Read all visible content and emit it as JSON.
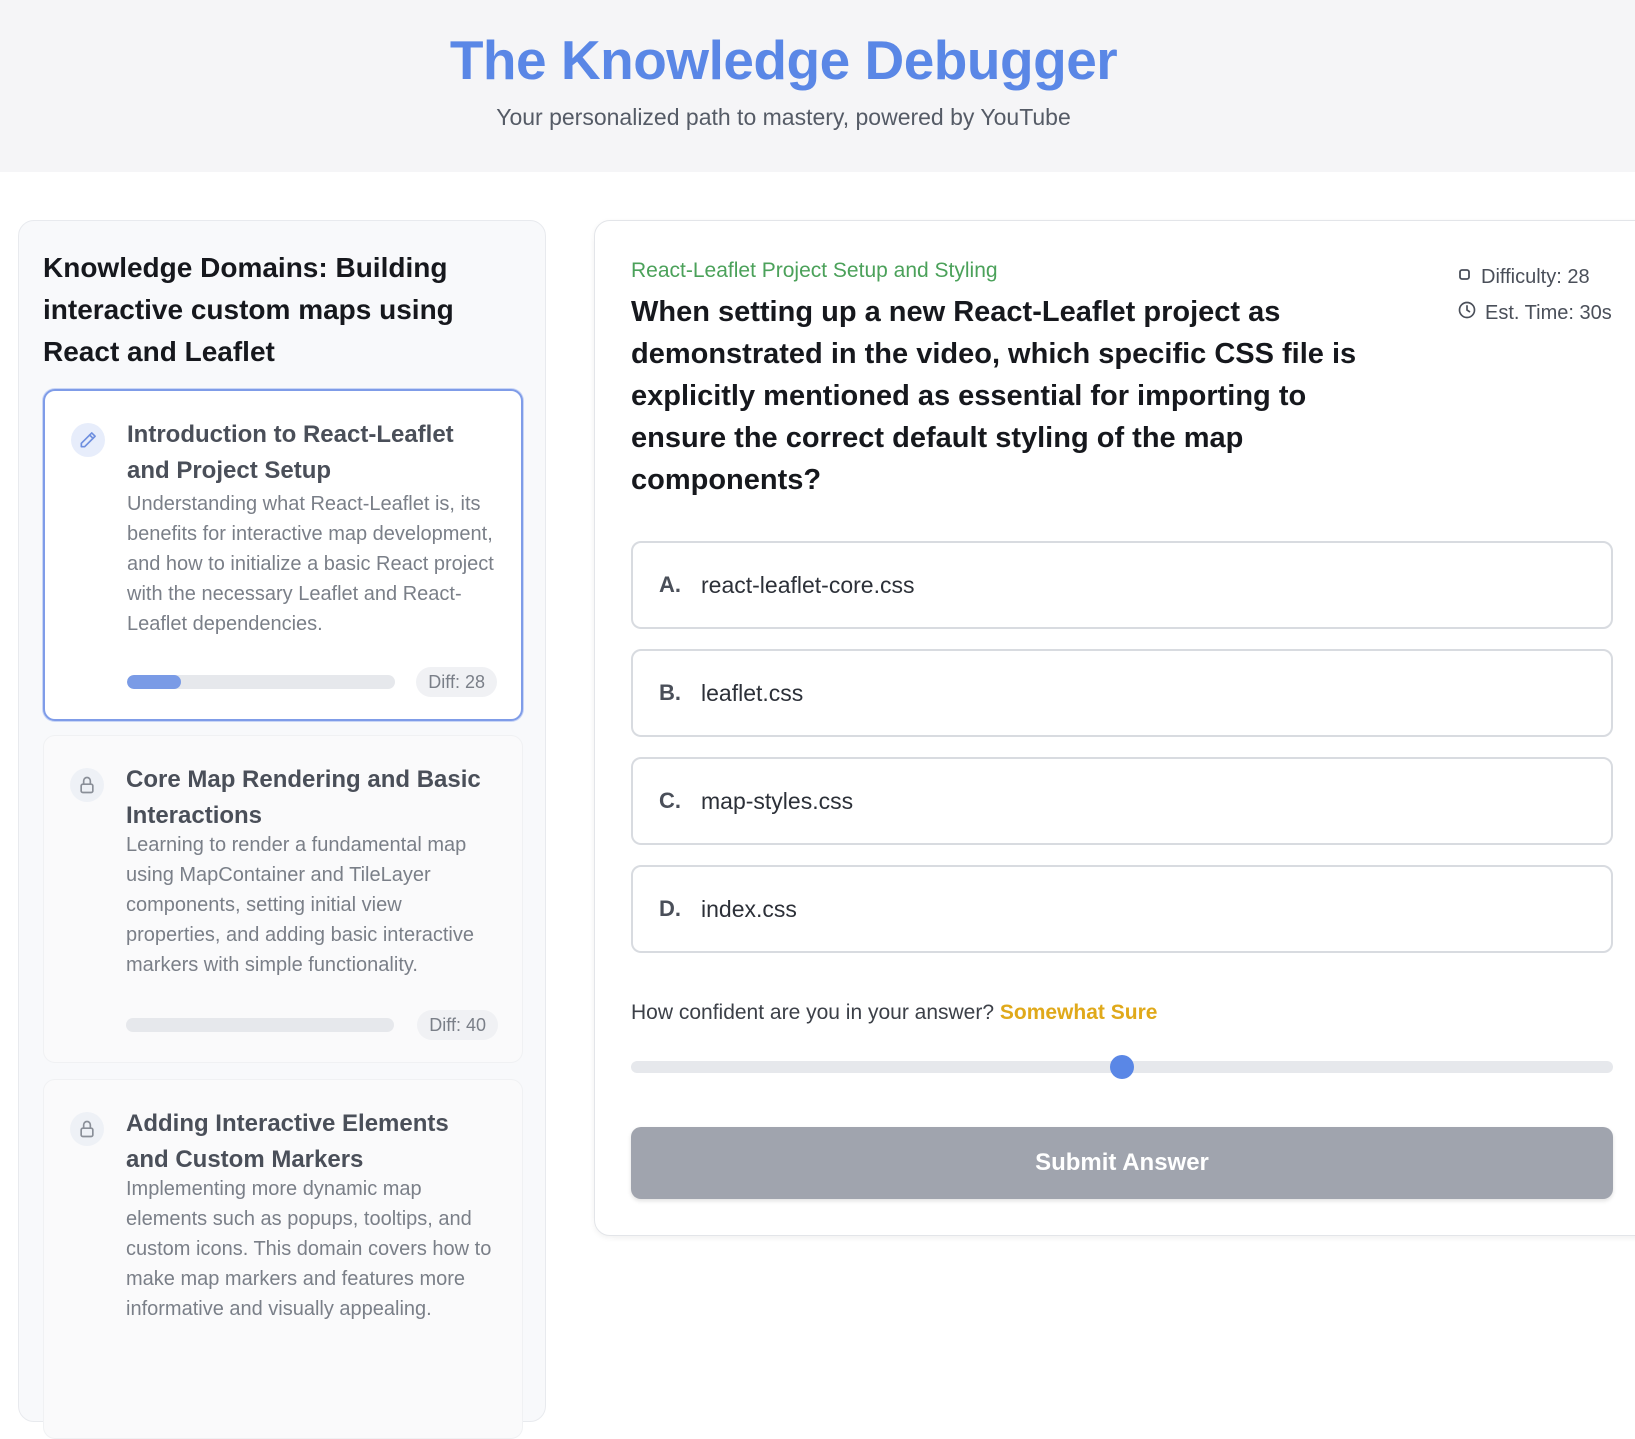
{
  "header": {
    "title": "The Knowledge Debugger",
    "subtitle": "Your personalized path to mastery, powered by YouTube"
  },
  "sidebar": {
    "title": "Knowledge Domains: Building interactive custom maps using React and Leaflet",
    "domains": [
      {
        "title": "Introduction to React-Leaflet and Project Setup",
        "description": "Understanding what React-Leaflet is, its benefits for interactive map development, and how to initialize a basic React project with the necessary Leaflet and React-Leaflet dependencies.",
        "diff": "Diff: 28",
        "progress": 0.2,
        "icon": "pencil-icon",
        "state": "active"
      },
      {
        "title": "Core Map Rendering and Basic Interactions",
        "description": "Learning to render a fundamental map using MapContainer and TileLayer components, setting initial view properties, and adding basic interactive markers with simple functionality.",
        "diff": "Diff: 40",
        "progress": 0,
        "icon": "lock-icon",
        "state": "locked"
      },
      {
        "title": "Adding Interactive Elements and Custom Markers",
        "description": "Implementing more dynamic map elements such as popups, tooltips, and custom icons. This domain covers how to make map markers and features more informative and visually appealing.",
        "icon": "lock-icon",
        "state": "locked"
      }
    ]
  },
  "question": {
    "topic": "React-Leaflet Project Setup and Styling",
    "difficulty": "Difficulty: 28",
    "est_time": "Est. Time: 30s",
    "text": "When setting up a new React-Leaflet project as demonstrated in the video, which specific CSS file is explicitly mentioned as essential for importing to ensure the correct default styling of the map components?",
    "options": [
      {
        "letter": "A.",
        "text": "react-leaflet-core.css"
      },
      {
        "letter": "B.",
        "text": "leaflet.css"
      },
      {
        "letter": "C.",
        "text": "map-styles.css"
      },
      {
        "letter": "D.",
        "text": "index.css"
      }
    ],
    "confidence_label": "How confident are you in your answer?",
    "confidence_value": "Somewhat Sure",
    "confidence_level": 0.5,
    "submit_label": "Submit Answer"
  },
  "colors": {
    "accent": "#5a87e6",
    "topic": "#4ba15a",
    "confidence": "#e0a91a",
    "submit_disabled": "#a0a4ae"
  }
}
